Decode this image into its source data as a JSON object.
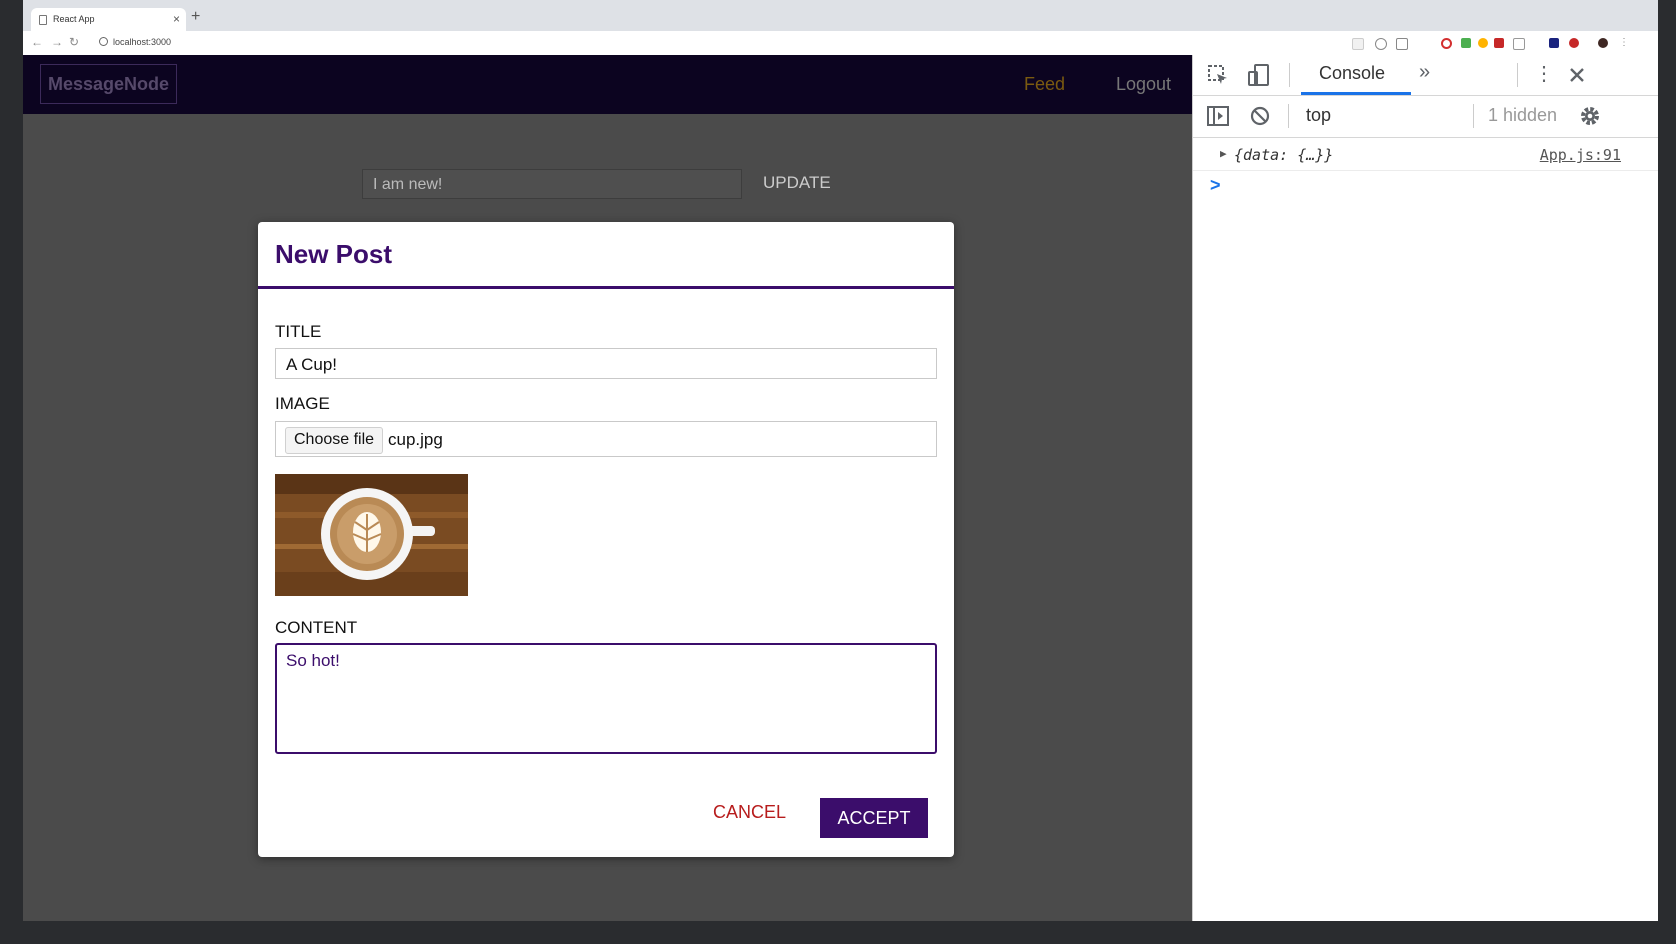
{
  "browser": {
    "tab_title": "React App",
    "tab_close": "×",
    "new_tab": "+",
    "url": "localhost:3000"
  },
  "app": {
    "logo": "MessageNode",
    "nav": {
      "feed": "Feed",
      "logout": "Logout"
    },
    "status": {
      "value": "I am new!",
      "update_label": "UPDATE"
    },
    "colors": {
      "brand": "#3b0d6b",
      "nav_bg": "#0c0420",
      "feed_link": "#b8860b",
      "cancel": "#b71c1c"
    }
  },
  "modal": {
    "title": "New Post",
    "title_label": "TITLE",
    "title_value": "A Cup!",
    "image_label": "IMAGE",
    "choose_file_label": "Choose file",
    "file_name": "cup.jpg",
    "content_label": "CONTENT",
    "content_value": "So hot!",
    "cancel_label": "CANCEL",
    "accept_label": "ACCEPT"
  },
  "devtools": {
    "console_tab": "Console",
    "more_tabs": "»",
    "context": "top",
    "hidden_count": "1 hidden",
    "log_object": "{data: {…}}",
    "log_source": "App.js:91",
    "prompt": ">"
  }
}
